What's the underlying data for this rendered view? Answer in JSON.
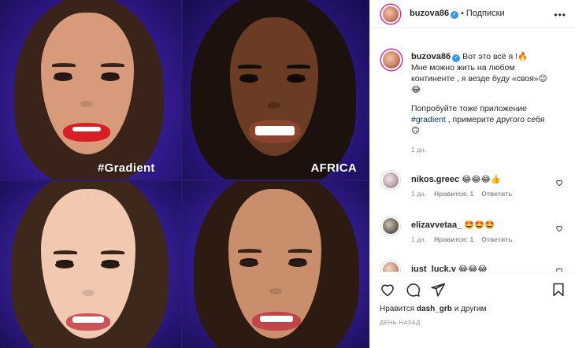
{
  "media": {
    "tiles": [
      {
        "label": "#Gradient",
        "skin": "#d79a7a",
        "hair": "#3a2318"
      },
      {
        "label": "AFRICA",
        "skin": "#6b3c24",
        "hair": "#1c110c"
      },
      {
        "label": "",
        "skin": "#f0c9b0",
        "hair": "#3e271b"
      },
      {
        "label": "",
        "skin": "#c98e6b",
        "hair": "#2d1a10"
      }
    ]
  },
  "post": {
    "author": "buzova86",
    "separator": "•",
    "follow_label": "Подписки",
    "more_icon": "more-options-icon"
  },
  "caption": {
    "author": "buzova86",
    "line1": "Вот это всё я !🔥",
    "line2": "Мне можно жить на любом",
    "line3": "континенте , я везде буду «своя»😉",
    "line4": "😂",
    "line5": "Попробуйте тоже приложение",
    "hashtag": "#gradient",
    "line6_rest": " , примерите другого себя",
    "line7": "🙃",
    "time": "1 дн."
  },
  "comments": [
    {
      "user": "nikos.greec",
      "text": "😂😂😂👍",
      "time": "1 дн.",
      "likes": "Нравится: 1",
      "reply": "Ответить"
    },
    {
      "user": "elizavvetaa_",
      "text": "🤩🤩🤩",
      "time": "1 дн.",
      "likes": "Нравится: 1",
      "reply": "Ответить"
    },
    {
      "user": "just_luck.y",
      "text": "😂😂😂",
      "time": "",
      "likes": "",
      "reply": ""
    }
  ],
  "actions": {
    "likes_prefix": "Нравится ",
    "likes_user": "dash_grb",
    "likes_suffix": " и другим",
    "when": "ДЕНЬ НАЗАД"
  },
  "colors": {
    "accent": "#3897f0",
    "hashtag": "#00376b",
    "muted": "#8e8e8e"
  }
}
